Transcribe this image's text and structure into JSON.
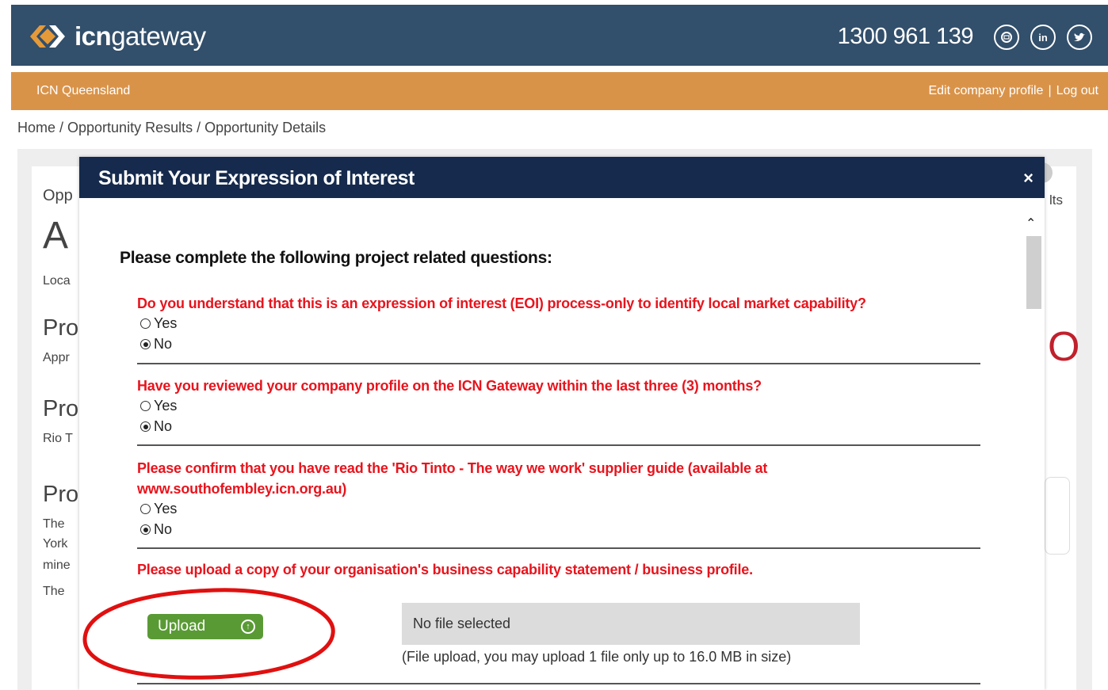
{
  "header": {
    "logo_bold": "icn",
    "logo_light": "gateway",
    "phone": "1300 961 139",
    "social": [
      "email-icon",
      "linkedin-icon",
      "twitter-icon"
    ]
  },
  "subbar": {
    "region": "ICN Queensland",
    "edit_profile": "Edit company profile",
    "separator": "|",
    "logout": "Log out"
  },
  "breadcrumb": "Home / Opportunity Results / Opportunity Details",
  "background_page": {
    "t1": "Opp",
    "t2": "A",
    "t3": "Loca",
    "t4": "Pro",
    "t5": "Appr",
    "t6": "Pro",
    "t7": "Rio T",
    "t8": "Pro",
    "t9": "The",
    "t10": "York",
    "t11": "mine",
    "t12": "The",
    "t13": "lts",
    "t14": "O"
  },
  "modal": {
    "title": "Submit Your Expression of Interest",
    "close": "×",
    "intro": "Please complete the following project related questions:",
    "questions": [
      {
        "text": "Do you understand that this is an expression of interest (EOI) process-only to identify local market capability?",
        "options": [
          "Yes",
          "No"
        ],
        "selected": "No"
      },
      {
        "text": "Have you reviewed your company profile on the ICN Gateway within the last three (3) months?",
        "options": [
          "Yes",
          "No"
        ],
        "selected": "No"
      },
      {
        "text": "Please confirm that you have read the 'Rio Tinto - The way we work' supplier guide (available at www.southofembley.icn.org.au)",
        "options": [
          "Yes",
          "No"
        ],
        "selected": "No"
      }
    ],
    "upload_question": "Please upload a copy of your organisation's business capability statement / business profile.",
    "upload_label": "Upload",
    "file_status": "No file selected",
    "file_note": "(File upload, you may upload 1 file only up to 16.0 MB in size)"
  },
  "colors": {
    "header_bg": "#324f6b",
    "subbar_bg": "#d99349",
    "modal_header_bg": "#152a4c",
    "question_red": "#e8141d",
    "upload_green": "#5a9a35",
    "annotation_red": "#e01010"
  }
}
